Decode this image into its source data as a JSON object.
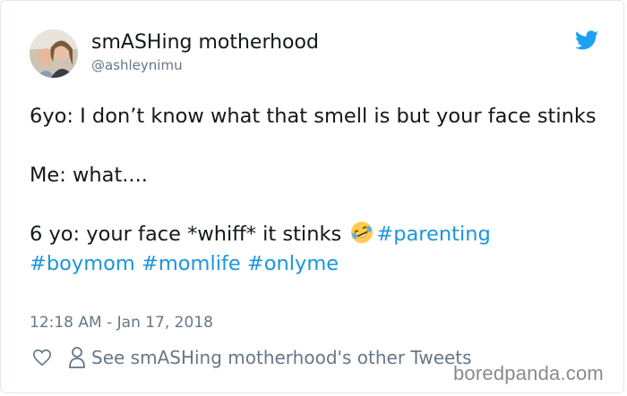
{
  "tweet": {
    "author_name": "smASHing motherhood",
    "author_handle": "@ashleynimu",
    "lines": {
      "l1": "6yo: I don’t know what that smell is but your face stinks",
      "l2": "Me: what....",
      "l3_text": "6 yo: your face *whiff* it stinks"
    },
    "hashtags": [
      "#parenting",
      "#boymom",
      "#momlife",
      "#onlyme"
    ],
    "emoji": "rolling-on-floor-laughing-emoji",
    "timestamp": "12:18 AM - Jan 17, 2018",
    "other_tweets_link": "See smASHing motherhood's other Tweets"
  },
  "watermark": "boredpanda.com",
  "colors": {
    "link": "#1b95e0",
    "secondary_text": "#657786",
    "twitter_blue": "#1da1f2",
    "border": "#e1e8ed"
  }
}
